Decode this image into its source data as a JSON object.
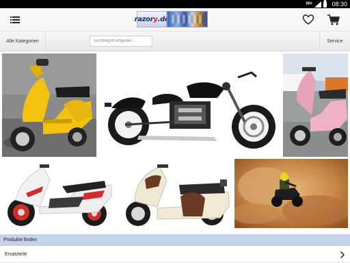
{
  "status_bar": {
    "network": "H+",
    "time": "08:30",
    "icons": [
      "network-type-icon",
      "signal-icon",
      "battery-icon"
    ]
  },
  "header": {
    "logo": {
      "text_main": "razor",
      "text_accent": "y",
      "text_suffix": ".de"
    },
    "icons": [
      "menu-icon",
      "heart-icon",
      "cart-icon"
    ]
  },
  "nav": {
    "categories_label": "Alle Kategorien",
    "search_placeholder": "Suchbegriff eingeben ...",
    "service_label": "Service"
  },
  "gallery": {
    "images": [
      "yellow-scooter-image",
      "black-chopper-motorcycle-image",
      "pink-scooter-image",
      "white-sport-scooter-image",
      "cream-brown-retro-scooter-image",
      "quad-bike-dust-image"
    ]
  },
  "sections": {
    "find_products": "Produkte finden",
    "spare_parts": "Ersatzteile"
  },
  "colors": {
    "section_header_bg": "#c4d3e8",
    "topbar_bg": "#f7f7f7",
    "logo_blue": "#1d2f6b",
    "logo_red": "#dd2222"
  }
}
